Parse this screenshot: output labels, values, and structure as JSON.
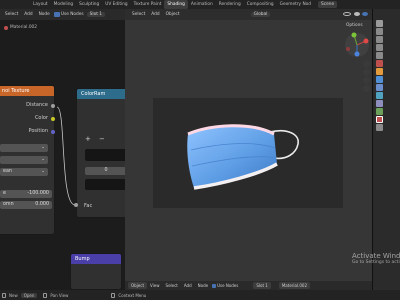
{
  "topbar": {
    "workspaces": [
      "Layout",
      "Modeling",
      "Sculpting",
      "UV Editing",
      "Texture Paint",
      "Shading",
      "Animation",
      "Rendering",
      "Compositing",
      "Geometry Nod"
    ],
    "active_workspace": "Shading",
    "scene_label": "Scene"
  },
  "node_editor": {
    "header": [
      "Select",
      "Add",
      "Node",
      "Use Nodes",
      "Slot 1"
    ],
    "breadcrumb": "Material.002",
    "voronoi_node": {
      "title": "noi Texture",
      "outputs": [
        "Distance",
        "Color",
        "Position"
      ],
      "dropdown_3": "ean",
      "field_1_label": "e",
      "field_1_value": "-100.000",
      "field_2_label": "omn",
      "field_2_value": "0.000"
    },
    "colorramp_node": {
      "title": "ColorRam",
      "plus": "+",
      "minus": "−",
      "pos_value": "0",
      "input_label": "Fac"
    },
    "bump_node": {
      "title": "Bump"
    }
  },
  "viewport": {
    "header": [
      "Select",
      "Add",
      "Object",
      "Global"
    ],
    "options_label": "Options",
    "footer": [
      "Object",
      "View",
      "Select",
      "Add",
      "Node",
      "Use Nodes",
      "Slot 1",
      "Material.002"
    ]
  },
  "watermark": {
    "line1": "Activate Windo",
    "line2": "Go to Settings to activ"
  },
  "statusbar": {
    "items": [
      "New",
      "Open",
      "Pan View",
      "Context Menu"
    ]
  },
  "colors": {
    "voronoi_header": "#c8662a",
    "colorramp_header": "#2e6c8c",
    "bump_header": "#4a3fa8",
    "mask_blue": "#5b9be3",
    "mask_edge": "#ffd8e6"
  }
}
